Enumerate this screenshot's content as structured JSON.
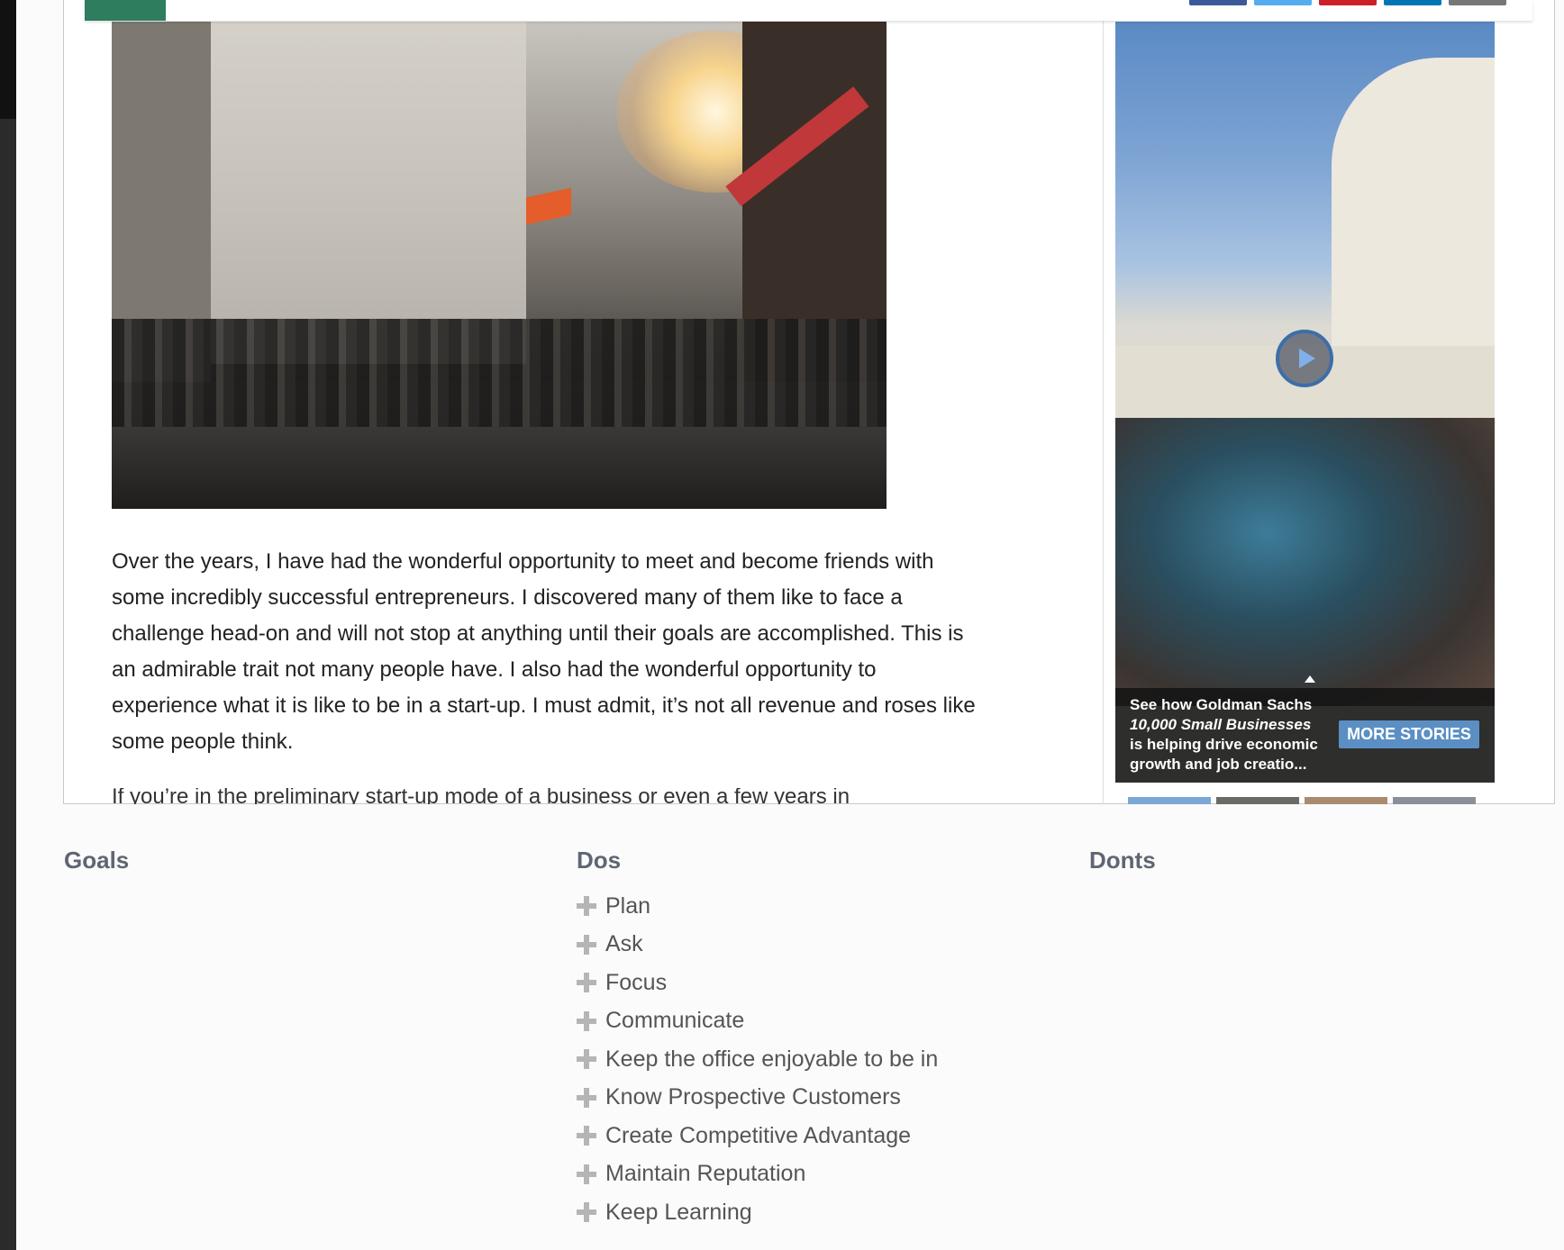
{
  "article": {
    "paragraph_1": "Over the years, I have had the wonderful opportunity to meet and become friends with some incredibly successful entrepreneurs. I discovered many of them like to face a challenge head-on and will not stop at anything until their goals are accomplished. This is an admirable trait not many people have. I also had the wonderful opportunity to experience what it is like to be in a start-up. I must admit, it’s not all revenue and roses like some people think.",
    "paragraph_2_partial": "If you’re in the preliminary start-up mode of a business or even a few years in"
  },
  "video_ad": {
    "caption_line1": "See how Goldman Sachs",
    "caption_em": "10,000 Small Businesses",
    "caption_line3": "is helping drive economic growth and job creatio...",
    "more_stories_label": "MORE STORIES",
    "accent_color": "#5b8fc4"
  },
  "share_colors": [
    "#3b5998",
    "#55acee",
    "#cb2027",
    "#0077b5",
    "#777777"
  ],
  "brand_color": "#2e7d5e",
  "columns": {
    "goals": {
      "heading": "Goals"
    },
    "dos": {
      "heading": "Dos",
      "items": [
        "Plan",
        "Ask",
        "Focus",
        "Communicate",
        "Keep the office enjoyable to be in",
        "Know Prospective Customers",
        "Create Competitive Advantage",
        "Maintain Reputation",
        "Keep Learning"
      ]
    },
    "donts": {
      "heading": "Donts"
    }
  }
}
